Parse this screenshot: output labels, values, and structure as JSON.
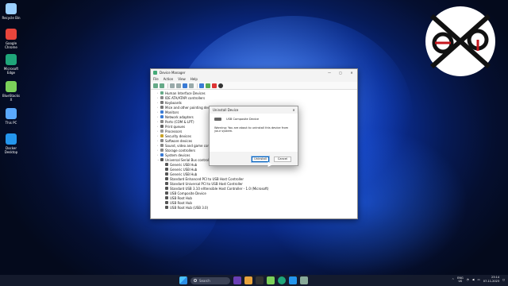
{
  "desktop": {
    "icons": [
      {
        "label": "Recycle Bin",
        "icon": "recycle-bin-icon",
        "color": "#9bd0ff"
      },
      {
        "label": "Google Chrome",
        "icon": "chrome-icon",
        "color": "#e8453c"
      },
      {
        "label": "Microsoft Edge",
        "icon": "edge-icon",
        "color": "#1fa67a"
      },
      {
        "label": "BlueStacks X",
        "icon": "bluestacks-icon",
        "color": "#7bd05a"
      },
      {
        "label": "This PC",
        "icon": "this-pc-icon",
        "color": "#5aa9ff"
      },
      {
        "label": "Docker Desktop",
        "icon": "docker-icon",
        "color": "#2496ed"
      }
    ]
  },
  "window": {
    "title": "Device Manager",
    "menu": [
      "File",
      "Action",
      "View",
      "Help"
    ],
    "tree": [
      {
        "label": "Human Interface Devices",
        "expanded": false,
        "level": 0,
        "color": "#6a8"
      },
      {
        "label": "IDE ATA/ATAPI controllers",
        "expanded": false,
        "level": 0,
        "color": "#888"
      },
      {
        "label": "Keyboards",
        "expanded": false,
        "level": 0,
        "color": "#777"
      },
      {
        "label": "Mice and other pointing devices",
        "expanded": false,
        "level": 0,
        "color": "#777"
      },
      {
        "label": "Monitors",
        "expanded": false,
        "level": 0,
        "color": "#3a7bd5"
      },
      {
        "label": "Network adapters",
        "expanded": false,
        "level": 0,
        "color": "#3a7bd5"
      },
      {
        "label": "Ports (COM & LPT)",
        "expanded": false,
        "level": 0,
        "color": "#888"
      },
      {
        "label": "Print queues",
        "expanded": false,
        "level": 0,
        "color": "#666"
      },
      {
        "label": "Processors",
        "expanded": false,
        "level": 0,
        "color": "#999"
      },
      {
        "label": "Security devices",
        "expanded": false,
        "level": 0,
        "color": "#c9a227"
      },
      {
        "label": "Software devices",
        "expanded": false,
        "level": 0,
        "color": "#888"
      },
      {
        "label": "Sound, video and game controllers",
        "expanded": false,
        "level": 0,
        "color": "#888"
      },
      {
        "label": "Storage controllers",
        "expanded": false,
        "level": 0,
        "color": "#888"
      },
      {
        "label": "System devices",
        "expanded": false,
        "level": 0,
        "color": "#3a7bd5"
      },
      {
        "label": "Universal Serial Bus controllers",
        "expanded": true,
        "level": 0,
        "color": "#555"
      },
      {
        "label": "Generic USB Hub",
        "level": 1,
        "color": "#555"
      },
      {
        "label": "Generic USB Hub",
        "level": 1,
        "color": "#555"
      },
      {
        "label": "Generic USB Hub",
        "level": 1,
        "color": "#555"
      },
      {
        "label": "Standard Enhanced PCI to USB Host Controller",
        "level": 1,
        "color": "#555"
      },
      {
        "label": "Standard Universal PCI to USB Host Controller",
        "level": 1,
        "color": "#555"
      },
      {
        "label": "Standard USB 3.10 eXtensible Host Controller - 1.0 (Microsoft)",
        "level": 1,
        "color": "#555"
      },
      {
        "label": "USB Composite Device",
        "level": 1,
        "color": "#555"
      },
      {
        "label": "USB Root Hub",
        "level": 1,
        "color": "#555"
      },
      {
        "label": "USB Root Hub",
        "level": 1,
        "color": "#555"
      },
      {
        "label": "USB Root Hub (USB 3.0)",
        "level": 1,
        "color": "#555"
      }
    ]
  },
  "dialog": {
    "title": "Uninstall Device",
    "device": "USB Composite Device",
    "warning": "Warning: You are about to uninstall this device from your system.",
    "uninstall_label": "Uninstall",
    "cancel_label": "Cancel",
    "close_glyph": "✕"
  },
  "taskbar": {
    "search_placeholder": "Search",
    "lang_top": "ENG",
    "lang_bottom": "US",
    "time": "23:14",
    "date": "07-11-2023"
  },
  "window_controls": {
    "minimize": "—",
    "maximize": "▢",
    "close": "✕"
  }
}
